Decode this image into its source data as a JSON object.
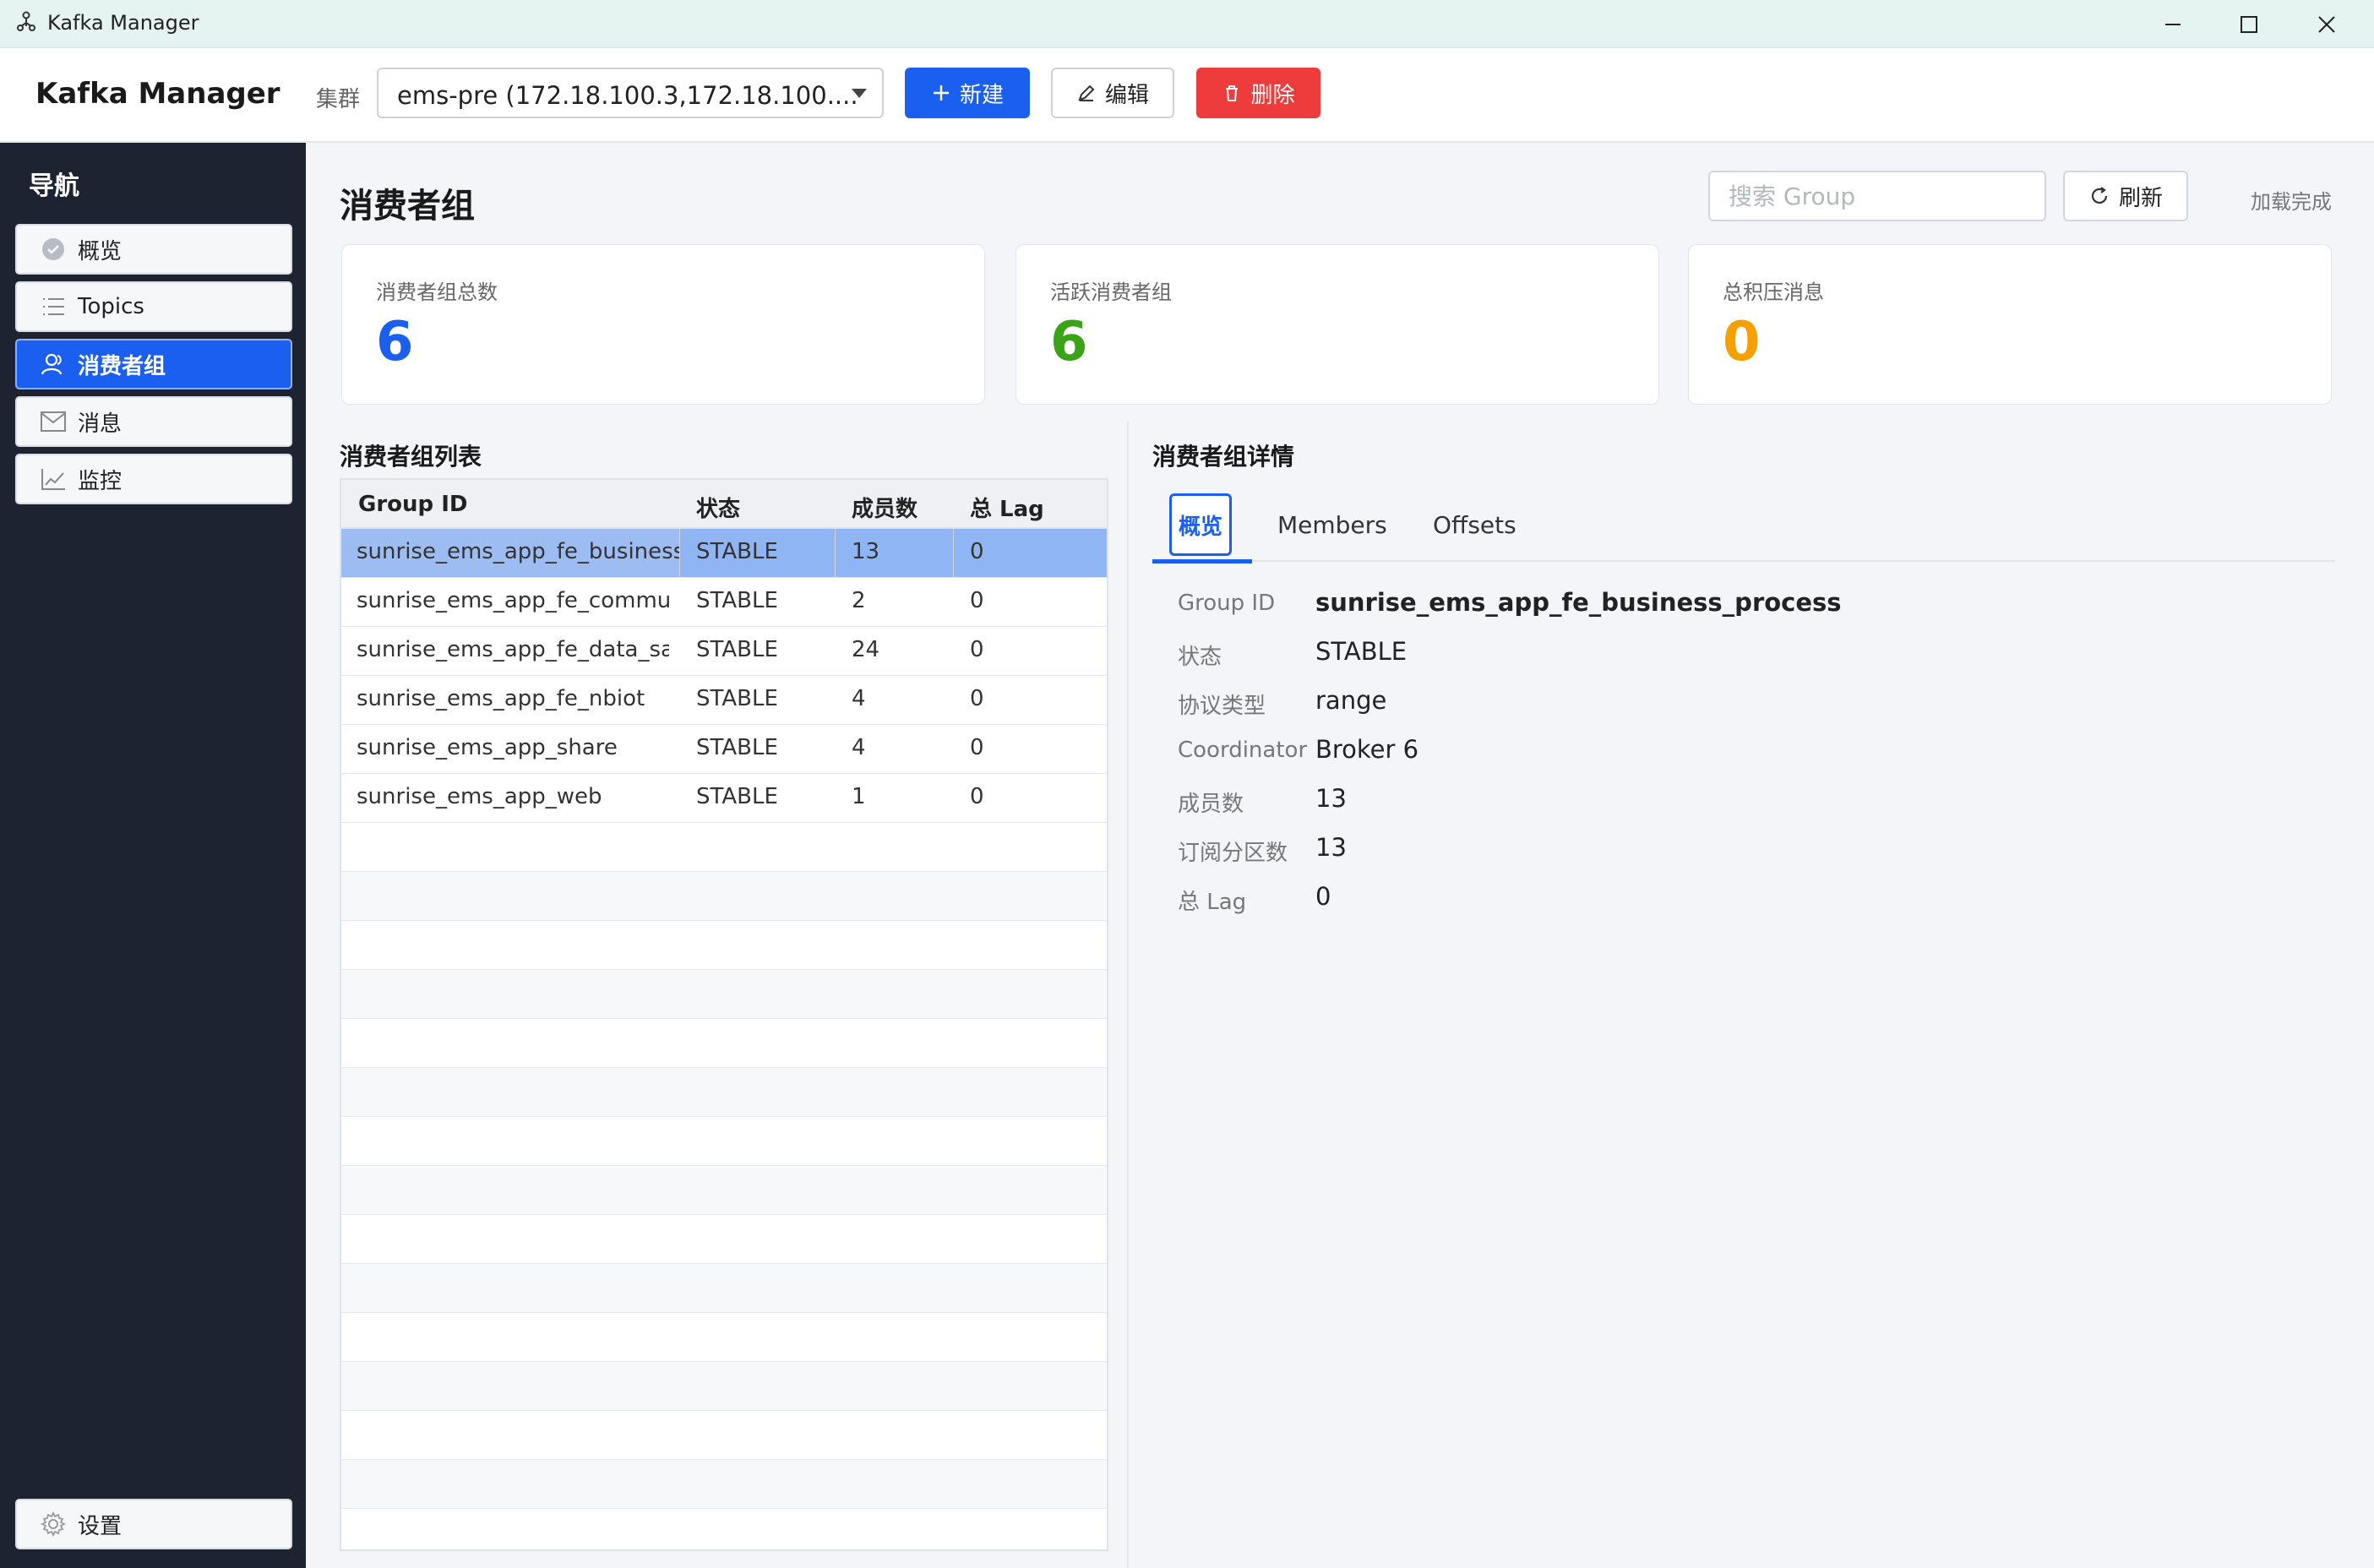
{
  "window": {
    "title": "Kafka Manager"
  },
  "header": {
    "brand": "Kafka Manager",
    "cluster_label": "集群",
    "cluster_value": "ems-pre (172.18.100.3,172.18.100....",
    "new_label": "新建",
    "edit_label": "编辑",
    "delete_label": "删除"
  },
  "sidebar": {
    "title": "导航",
    "items": [
      {
        "label": "概览",
        "icon": "check-circle-icon"
      },
      {
        "label": "Topics",
        "icon": "list-icon"
      },
      {
        "label": "消费者组",
        "icon": "users-icon",
        "active": true
      },
      {
        "label": "消息",
        "icon": "mail-icon"
      },
      {
        "label": "监控",
        "icon": "line-chart-icon"
      }
    ],
    "settings_label": "设置"
  },
  "main": {
    "title": "消费者组",
    "search_placeholder": "搜索 Group",
    "refresh_label": "刷新",
    "status": "加载完成"
  },
  "stats": [
    {
      "label": "消费者组总数",
      "value": "6",
      "color": "#1b5ff0"
    },
    {
      "label": "活跃消费者组",
      "value": "6",
      "color": "#3aa317"
    },
    {
      "label": "总积压消息",
      "value": "0",
      "color": "#f5a000"
    }
  ],
  "list": {
    "title": "消费者组列表",
    "columns": [
      "Group ID",
      "状态",
      "成员数",
      "总 Lag"
    ],
    "rows": [
      [
        "sunrise_ems_app_fe_business...",
        "STABLE",
        "13",
        "0"
      ],
      [
        "sunrise_ems_app_fe_commun...",
        "STABLE",
        "2",
        "0"
      ],
      [
        "sunrise_ems_app_fe_data_save",
        "STABLE",
        "24",
        "0"
      ],
      [
        "sunrise_ems_app_fe_nbiot",
        "STABLE",
        "4",
        "0"
      ],
      [
        "sunrise_ems_app_share",
        "STABLE",
        "4",
        "0"
      ],
      [
        "sunrise_ems_app_web",
        "STABLE",
        "1",
        "0"
      ]
    ]
  },
  "detail": {
    "title": "消费者组详情",
    "tabs": [
      "概览",
      "Members",
      "Offsets"
    ],
    "fields": [
      {
        "key": "Group ID",
        "value": "sunrise_ems_app_fe_business_process"
      },
      {
        "key": "状态",
        "value": "STABLE"
      },
      {
        "key": "协议类型",
        "value": "range"
      },
      {
        "key": "Coordinator",
        "value": "Broker 6"
      },
      {
        "key": "成员数",
        "value": "13"
      },
      {
        "key": "订阅分区数",
        "value": "13"
      },
      {
        "key": "总 Lag",
        "value": "0"
      }
    ]
  }
}
